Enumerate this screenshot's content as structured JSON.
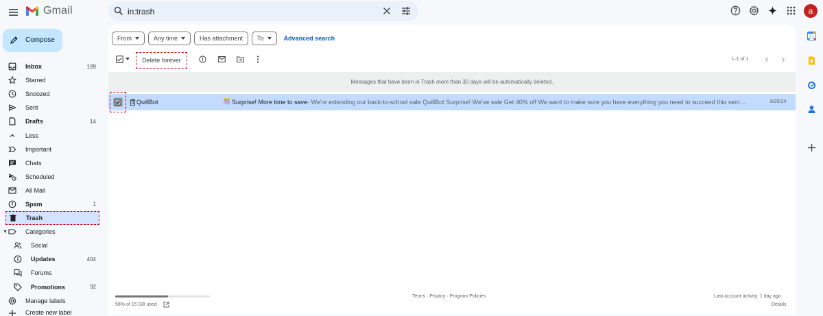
{
  "app": {
    "name": "Gmail"
  },
  "search": {
    "value": "in:trash"
  },
  "header": {
    "avatar_letter": "a"
  },
  "compose": {
    "label": "Compose"
  },
  "nav": {
    "items": [
      {
        "label": "Inbox",
        "count": "199",
        "icon": "inbox-icon",
        "bold": true
      },
      {
        "label": "Starred",
        "count": "",
        "icon": "star-icon"
      },
      {
        "label": "Snoozed",
        "count": "",
        "icon": "clock-icon"
      },
      {
        "label": "Sent",
        "count": "",
        "icon": "send-icon"
      },
      {
        "label": "Drafts",
        "count": "14",
        "icon": "draft-icon",
        "bold": true
      },
      {
        "label": "Less",
        "count": "",
        "icon": "chevron-up-icon"
      },
      {
        "label": "Important",
        "count": "",
        "icon": "important-icon"
      },
      {
        "label": "Chats",
        "count": "",
        "icon": "chat-icon"
      },
      {
        "label": "Scheduled",
        "count": "",
        "icon": "scheduled-send-icon"
      },
      {
        "label": "All Mail",
        "count": "",
        "icon": "all-mail-icon"
      },
      {
        "label": "Spam",
        "count": "1",
        "icon": "spam-icon",
        "bold": true
      },
      {
        "label": "Trash",
        "count": "",
        "icon": "trash-icon",
        "active": true
      },
      {
        "label": "Categories",
        "count": "",
        "icon": "label-icon"
      },
      {
        "label": "Social",
        "count": "",
        "icon": "people-icon"
      },
      {
        "label": "Updates",
        "count": "404",
        "icon": "info-icon",
        "bold": true
      },
      {
        "label": "Forums",
        "count": "",
        "icon": "forum-icon"
      },
      {
        "label": "Promotions",
        "count": "92",
        "icon": "tag-icon",
        "bold": true
      },
      {
        "label": "Manage labels",
        "count": "",
        "icon": "gear-icon"
      },
      {
        "label": "Create new label",
        "count": "",
        "icon": "plus-icon"
      }
    ]
  },
  "filters": {
    "from": "From",
    "time": "Any time",
    "attachment": "Has attachment",
    "to": "To",
    "advanced": "Advanced search"
  },
  "toolbar": {
    "delete_forever": "Delete forever",
    "pager": "1–1 of 1"
  },
  "notice": "Messages that have been in Trash more than 30 days will be automatically deleted.",
  "messages": [
    {
      "sender": "QuillBot",
      "emoji": "🎊",
      "subject": "Surprise! More time to save",
      "snippet": " - We're extending our back-to-school sale QuillBot Surprise! We've sale Get 40% off We want to make sure you have everything you need to succeed this seme...",
      "date": "8/29/24"
    }
  ],
  "footer": {
    "storage": "56% of 15 GB used",
    "storage_fraction": 0.56,
    "terms": "Terms",
    "privacy": "Privacy",
    "policies": "Program Policies",
    "activity": "Last account activity: 1 day ago",
    "details": "Details"
  },
  "colors": {
    "accent": "#0b57d0",
    "compose_bg": "#c2e7ff",
    "selected_row": "#c2dbff",
    "nav_active": "#d3e3fd",
    "highlight": "#d60000"
  }
}
